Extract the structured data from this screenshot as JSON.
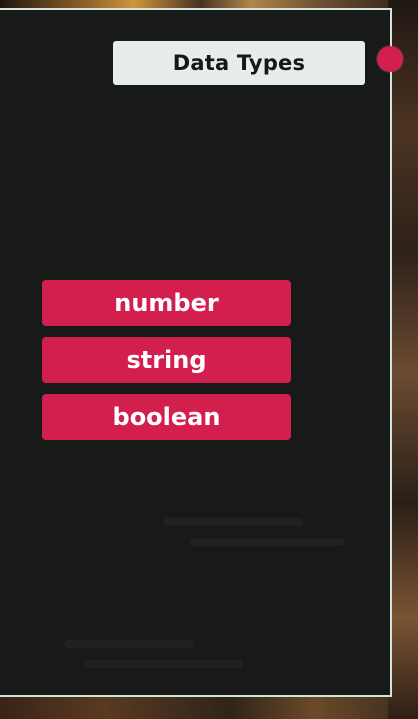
{
  "title": "Data Types",
  "types": [
    "number",
    "string",
    "boolean"
  ],
  "colors": {
    "panel": "#171a19",
    "accent": "#d31f4d",
    "title_bg": "#e8ecea",
    "border": "#cfe5d8"
  }
}
